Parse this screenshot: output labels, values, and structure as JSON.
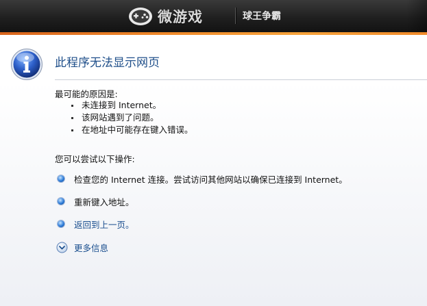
{
  "header": {
    "logo_text": "微游戏",
    "game_title": "球王争霸"
  },
  "error": {
    "title": "此程序无法显示网页",
    "reasons_label": "最可能的原因是:",
    "reasons": [
      "未连接到 Internet。",
      "该网站遇到了问题。",
      "在地址中可能存在键入错误。"
    ],
    "actions_label": "您可以尝试以下操作:",
    "actions": [
      "检查您的 Internet 连接。尝试访问其他网站以确保已连接到 Internet。",
      "重新键入地址。",
      "返回到上一页。"
    ],
    "more_info": "更多信息"
  },
  "colors": {
    "header_bg": "#1f1f1f",
    "header_accent": "#f08a2a",
    "title_blue": "#1f4f8a",
    "link_blue": "#1b4f8f"
  }
}
